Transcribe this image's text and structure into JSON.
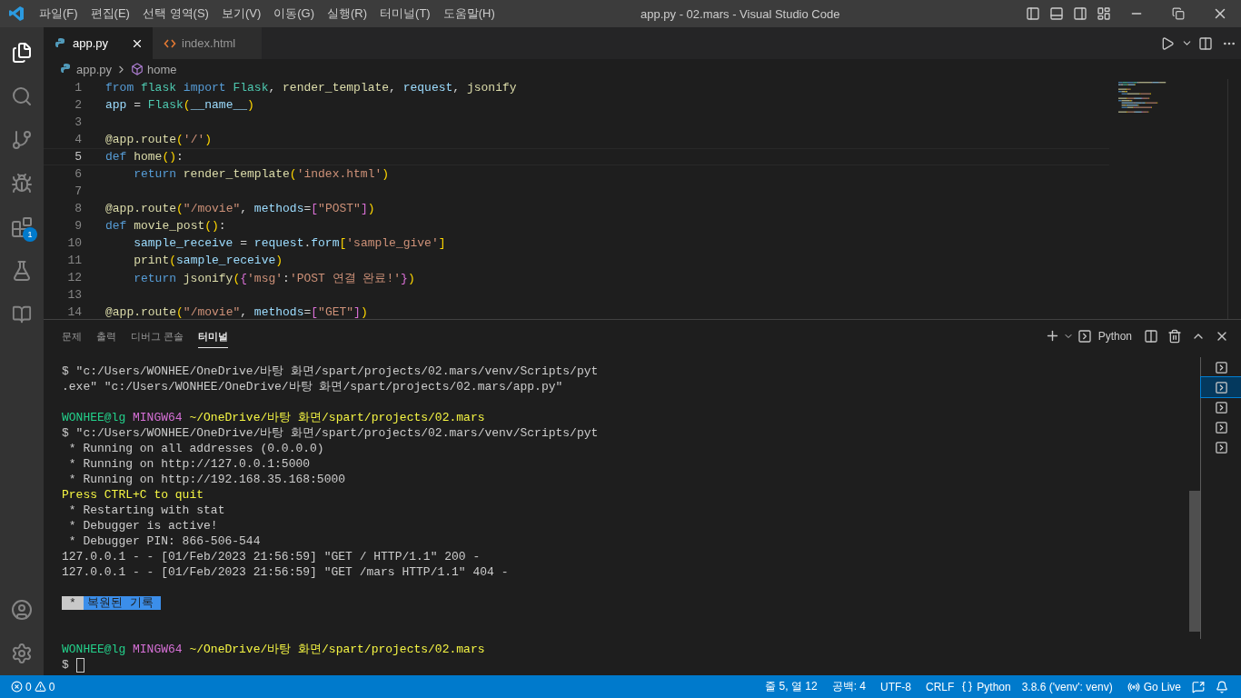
{
  "window": {
    "title": "app.py - 02.mars - Visual Studio Code"
  },
  "menu": [
    "파일(F)",
    "편집(E)",
    "선택 영역(S)",
    "보기(V)",
    "이동(G)",
    "실행(R)",
    "터미널(T)",
    "도움말(H)"
  ],
  "activity_bar": {
    "extensions_badge": "1"
  },
  "tabs": [
    {
      "label": "app.py",
      "kind": "python",
      "selected": true
    },
    {
      "label": "index.html",
      "kind": "html",
      "selected": false
    }
  ],
  "breadcrumb": [
    {
      "label": "app.py",
      "kind": "python"
    },
    {
      "label": "home",
      "kind": "symbol"
    }
  ],
  "editor": {
    "lines": [
      {
        "number": "1",
        "current": false,
        "indented": false,
        "tokens": [
          {
            "text": "from ",
            "kind": "kw"
          },
          {
            "text": "flask ",
            "kind": "cls"
          },
          {
            "text": "import ",
            "kind": "kw"
          },
          {
            "text": "Flask",
            "kind": "cls"
          },
          {
            "text": ", ",
            "kind": "p"
          },
          {
            "text": "render_template",
            "kind": "fn"
          },
          {
            "text": ", ",
            "kind": "p"
          },
          {
            "text": "request",
            "kind": "var"
          },
          {
            "text": ", ",
            "kind": "p"
          },
          {
            "text": "jsonify",
            "kind": "fn"
          }
        ]
      },
      {
        "number": "2",
        "current": false,
        "indented": false,
        "tokens": [
          {
            "text": "app",
            "kind": "var"
          },
          {
            "text": " = ",
            "kind": "p"
          },
          {
            "text": "Flask",
            "kind": "cls"
          },
          {
            "text": "(",
            "kind": "br1"
          },
          {
            "text": "__name__",
            "kind": "var"
          },
          {
            "text": ")",
            "kind": "br1"
          }
        ]
      },
      {
        "number": "3",
        "current": false
      },
      {
        "number": "4",
        "current": false,
        "indented": false,
        "tokens": [
          {
            "text": "@app.route",
            "kind": "fn"
          },
          {
            "text": "(",
            "kind": "br1"
          },
          {
            "text": "'/'",
            "kind": "str"
          },
          {
            "text": ")",
            "kind": "br1"
          }
        ]
      },
      {
        "number": "5",
        "current": true,
        "indented": false,
        "tokens": [
          {
            "text": "def ",
            "kind": "kw"
          },
          {
            "text": "home",
            "kind": "fn"
          },
          {
            "text": "()",
            "kind": "br1"
          },
          {
            "text": ":",
            "kind": "p"
          }
        ]
      },
      {
        "number": "6",
        "current": false,
        "indented": true,
        "tokens": [
          {
            "text": "return ",
            "kind": "kw"
          },
          {
            "text": "render_template",
            "kind": "fn"
          },
          {
            "text": "(",
            "kind": "br1"
          },
          {
            "text": "'index.html'",
            "kind": "str"
          },
          {
            "text": ")",
            "kind": "br1"
          }
        ]
      },
      {
        "number": "7",
        "current": false
      },
      {
        "number": "8",
        "current": false,
        "indented": false,
        "tokens": [
          {
            "text": "@app.route",
            "kind": "fn"
          },
          {
            "text": "(",
            "kind": "br1"
          },
          {
            "text": "\"/movie\"",
            "kind": "str"
          },
          {
            "text": ", ",
            "kind": "p"
          },
          {
            "text": "methods",
            "kind": "var"
          },
          {
            "text": "=",
            "kind": "p"
          },
          {
            "text": "[",
            "kind": "br2"
          },
          {
            "text": "\"POST\"",
            "kind": "str"
          },
          {
            "text": "]",
            "kind": "br2"
          },
          {
            "text": ")",
            "kind": "br1"
          }
        ]
      },
      {
        "number": "9",
        "current": false,
        "indented": false,
        "tokens": [
          {
            "text": "def ",
            "kind": "kw"
          },
          {
            "text": "movie_post",
            "kind": "fn"
          },
          {
            "text": "()",
            "kind": "br1"
          },
          {
            "text": ":",
            "kind": "p"
          }
        ]
      },
      {
        "number": "10",
        "current": false,
        "indented": true,
        "tokens": [
          {
            "text": "sample_receive",
            "kind": "var"
          },
          {
            "text": " = ",
            "kind": "p"
          },
          {
            "text": "request",
            "kind": "var"
          },
          {
            "text": ".",
            "kind": "p"
          },
          {
            "text": "form",
            "kind": "var"
          },
          {
            "text": "[",
            "kind": "br1"
          },
          {
            "text": "'sample_give'",
            "kind": "str"
          },
          {
            "text": "]",
            "kind": "br1"
          }
        ]
      },
      {
        "number": "11",
        "current": false,
        "indented": true,
        "tokens": [
          {
            "text": "print",
            "kind": "fn"
          },
          {
            "text": "(",
            "kind": "br1"
          },
          {
            "text": "sample_receive",
            "kind": "var"
          },
          {
            "text": ")",
            "kind": "br1"
          }
        ]
      },
      {
        "number": "12",
        "current": false,
        "indented": true,
        "tokens": [
          {
            "text": "return ",
            "kind": "kw"
          },
          {
            "text": "jsonify",
            "kind": "fn"
          },
          {
            "text": "(",
            "kind": "br1"
          },
          {
            "text": "{",
            "kind": "br2"
          },
          {
            "text": "'msg'",
            "kind": "str"
          },
          {
            "text": ":",
            "kind": "p"
          },
          {
            "text": "'POST 연결 완료!'",
            "kind": "str"
          },
          {
            "text": "}",
            "kind": "br2"
          },
          {
            "text": ")",
            "kind": "br1"
          }
        ]
      },
      {
        "number": "13",
        "current": false
      },
      {
        "number": "14",
        "current": false,
        "indented": false,
        "tokens": [
          {
            "text": "@app.route",
            "kind": "fn"
          },
          {
            "text": "(",
            "kind": "br1"
          },
          {
            "text": "\"/movie\"",
            "kind": "str"
          },
          {
            "text": ", ",
            "kind": "p"
          },
          {
            "text": "methods",
            "kind": "var"
          },
          {
            "text": "=",
            "kind": "p"
          },
          {
            "text": "[",
            "kind": "br2"
          },
          {
            "text": "\"GET\"",
            "kind": "str"
          },
          {
            "text": "]",
            "kind": "br2"
          },
          {
            "text": ")",
            "kind": "br1"
          }
        ]
      }
    ]
  },
  "panel": {
    "tabs": [
      {
        "label": "문제",
        "selected": false
      },
      {
        "label": "출력",
        "selected": false
      },
      {
        "label": "디버그 콘솔",
        "selected": false
      },
      {
        "label": "터미널",
        "selected": true
      }
    ],
    "terminal_name": "Python",
    "lines": [
      {
        "kind": "output",
        "segments": [
          {
            "text": "$ \"c:/Users/WONHEE/OneDrive/바탕 화면/spart/projects/02.mars/venv/Scripts/pyt",
            "kind": "plain"
          }
        ]
      },
      {
        "kind": "output",
        "segments": [
          {
            "text": ".exe\" \"c:/Users/WONHEE/OneDrive/바탕 화면/spart/projects/02.mars/app.py\"",
            "kind": "plain"
          }
        ]
      },
      {
        "kind": "blank"
      },
      {
        "kind": "output",
        "segments": [
          {
            "text": "WONHEE@lg ",
            "kind": "green"
          },
          {
            "text": "MINGW64 ",
            "kind": "magenta"
          },
          {
            "text": "~/OneDrive/바탕 화면/spart/projects/02.mars",
            "kind": "yellow"
          }
        ]
      },
      {
        "kind": "output",
        "segments": [
          {
            "text": "$ \"c:/Users/WONHEE/OneDrive/바탕 화면/spart/projects/02.mars/venv/Scripts/pyt",
            "kind": "plain"
          }
        ]
      },
      {
        "kind": "output",
        "segments": [
          {
            "text": " * Running on all addresses (0.0.0.0)",
            "kind": "plain"
          }
        ]
      },
      {
        "kind": "output",
        "segments": [
          {
            "text": " * Running on http://127.0.0.1:5000",
            "kind": "plain"
          }
        ]
      },
      {
        "kind": "output",
        "segments": [
          {
            "text": " * Running on http://192.168.35.168:5000",
            "kind": "plain"
          }
        ]
      },
      {
        "kind": "output",
        "segments": [
          {
            "text": "Press CTRL+C to quit",
            "kind": "yellow"
          }
        ]
      },
      {
        "kind": "output",
        "segments": [
          {
            "text": " * Restarting with stat",
            "kind": "plain"
          }
        ]
      },
      {
        "kind": "output",
        "segments": [
          {
            "text": " * Debugger is active!",
            "kind": "plain"
          }
        ]
      },
      {
        "kind": "output",
        "segments": [
          {
            "text": " * Debugger PIN: 866-506-544",
            "kind": "plain"
          }
        ]
      },
      {
        "kind": "output",
        "segments": [
          {
            "text": "127.0.0.1 - - [01/Feb/2023 21:56:59] \"GET / HTTP/1.1\" 200 -",
            "kind": "plain"
          }
        ]
      },
      {
        "kind": "output",
        "segments": [
          {
            "text": "127.0.0.1 - - [01/Feb/2023 21:56:59] \"GET /mars HTTP/1.1\" 404 -",
            "kind": "plain"
          }
        ]
      },
      {
        "kind": "blank"
      },
      {
        "kind": "restored",
        "marker": "*",
        "text": "복원된 기록"
      },
      {
        "kind": "blank"
      },
      {
        "kind": "blank"
      },
      {
        "kind": "output",
        "segments": [
          {
            "text": "WONHEE@lg ",
            "kind": "green"
          },
          {
            "text": "MINGW64 ",
            "kind": "magenta"
          },
          {
            "text": "~/OneDrive/바탕 화면/spart/projects/02.mars",
            "kind": "yellow"
          }
        ]
      },
      {
        "kind": "prompt",
        "text": "$"
      }
    ],
    "instances": [
      {
        "selected": false
      },
      {
        "selected": true
      },
      {
        "selected": false
      },
      {
        "selected": false
      },
      {
        "selected": false
      }
    ]
  },
  "status_bar": {
    "errors": "0",
    "warnings": "0",
    "items": [
      {
        "kind": "text",
        "label": "줄 5, 열 12"
      },
      {
        "kind": "text",
        "label": "공백: 4"
      },
      {
        "kind": "text",
        "label": "UTF-8"
      },
      {
        "kind": "text",
        "label": "CRLF"
      },
      {
        "kind": "language",
        "label": "Python"
      },
      {
        "kind": "text",
        "label": "3.8.6 ('venv': venv)"
      },
      {
        "kind": "live",
        "label": "Go Live"
      }
    ]
  }
}
